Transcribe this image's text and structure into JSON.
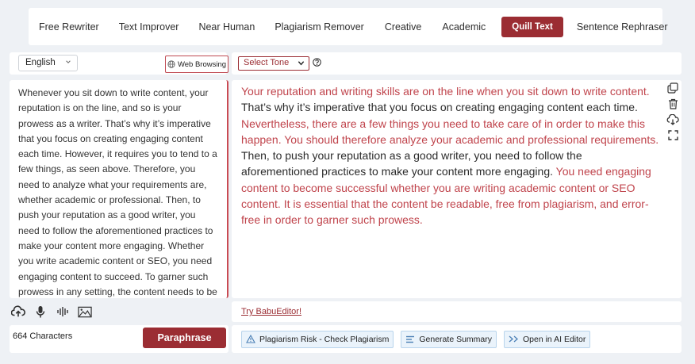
{
  "modes": [
    {
      "label": "Free Rewriter",
      "active": false
    },
    {
      "label": "Text Improver",
      "active": false
    },
    {
      "label": "Near Human",
      "active": false
    },
    {
      "label": "Plagiarism Remover",
      "active": false
    },
    {
      "label": "Creative",
      "active": false
    },
    {
      "label": "Academic",
      "active": false
    },
    {
      "label": "Quill Text",
      "active": true
    },
    {
      "label": "Sentence Rephraser",
      "active": false
    }
  ],
  "input_panel": {
    "language": "English",
    "web_browsing_label": "Web Browsing",
    "text": "Whenever you sit down to write content, your reputation is on the line, and so is your prowess as a writer. That’s why it’s imperative that you focus on creating engaging content each time. However, it requires you to tend to a few things, as seen above. Therefore, you need to analyze what your requirements are, whether academic or professional. Then, to push your reputation as a good writer, you need to follow the aforementioned practices to make your content more engaging. Whether you write academic content or SEO, you need engaging content to succeed. To garner such prowess in any setting, the content needs to be readable, free from plagiarism, and error-free.",
    "char_count": "664 Characters",
    "paraphrase_label": "Paraphrase"
  },
  "output_panel": {
    "tone_label": "Select Tone",
    "segments": [
      {
        "text": "Your reputation and writing skills are on the line when you sit down to write content.",
        "changed": true
      },
      {
        "text": " That’s why it’s imperative that you focus on creating engaging content each time.",
        "changed": false
      },
      {
        "text": " Nevertheless, there are a few things you need to take care of in order to make this happen. You should therefore analyze your academic and professional requirements.",
        "changed": true
      },
      {
        "text": " Then, to push your reputation as a good writer, you need to follow the aforementioned practices to make your content more engaging.",
        "changed": false
      },
      {
        "text": " You need engaging content to become successful whether you are writing academic content or SEO content. It is essential that the content be readable, free from plagiarism, and error-free in order to garner such prowess.",
        "changed": true
      }
    ],
    "try_link": "Try BabuEditor!",
    "actions": [
      {
        "label": "Plagiarism Risk - Check Plagiarism",
        "icon": "warning-icon"
      },
      {
        "label": "Generate Summary",
        "icon": "summary-icon"
      },
      {
        "label": "Open in AI Editor",
        "icon": "ai-editor-icon"
      }
    ]
  },
  "colors": {
    "accent": "#9b2d33",
    "changed_text": "#c0444c",
    "action_bg": "#eaf3fb"
  }
}
